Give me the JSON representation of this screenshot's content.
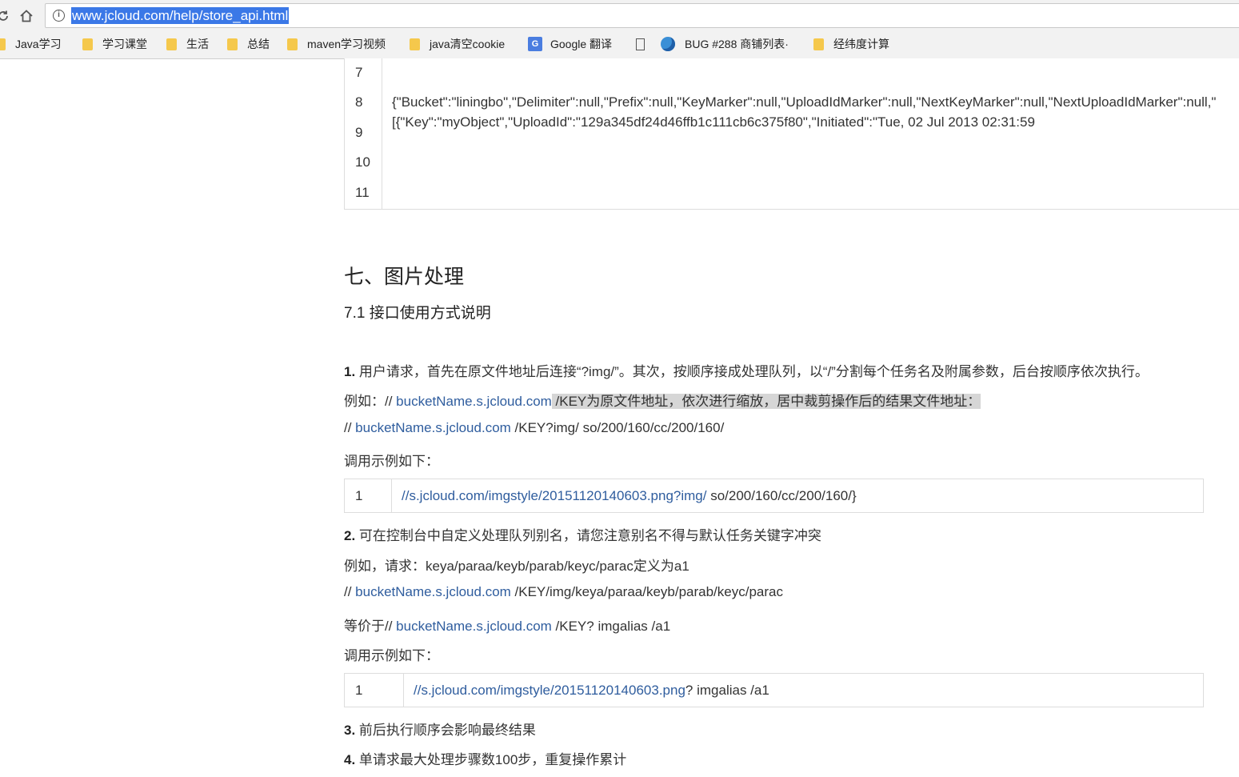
{
  "browser": {
    "reload_icon": "reload-icon",
    "home_icon": "home-icon",
    "url": "www.jcloud.com/help/store_api.html",
    "bookmarks": [
      {
        "label": "Java学习",
        "icon": "folder-icon"
      },
      {
        "label": "学习课堂",
        "icon": "folder-icon"
      },
      {
        "label": "生活",
        "icon": "folder-icon"
      },
      {
        "label": "总结",
        "icon": "folder-icon"
      },
      {
        "label": "maven学习视频",
        "icon": "folder-icon"
      },
      {
        "label": "java清空cookie",
        "icon": "folder-icon"
      },
      {
        "label": "Google 翻译",
        "icon": "google-translate-icon"
      },
      {
        "label": "",
        "icon": "page-icon"
      },
      {
        "label": "BUG #288 商铺列表·",
        "icon": "globe-icon"
      },
      {
        "label": "经纬度计算",
        "icon": "folder-icon"
      }
    ]
  },
  "code_top": {
    "line_numbers": [
      "7",
      "8",
      "9",
      "10",
      "11"
    ],
    "lines": [
      "{\"Bucket\":\"liningbo\",\"Delimiter\":null,\"Prefix\":null,\"KeyMarker\":null,\"UploadIdMarker\":null,\"NextKeyMarker\":null,\"NextUploadIdMarker\":null,\"",
      "[{\"Key\":\"myObject\",\"UploadId\":\"129a345df24d46ffb1c111cb6c375f80\",\"Initiated\":\"Tue, 02 Jul 2013 02:31:59"
    ]
  },
  "section": {
    "title": "七、图片处理",
    "subtitle": "7.1 接口使用方式说明"
  },
  "items": {
    "p1_num": "1.",
    "p1_text": " 用户请求，首先在原文件地址后连接“?img/”。其次，按顺序接成处理队列，以“/”分割每个任务名及附属参数，后台按顺序依次执行。",
    "p2_prefix": "例如：// ",
    "p2_link": "bucketName.s.jcloud.com",
    "p2_hl": " /KEY为原文件地址，依次进行缩放，居中裁剪操作后的结果文件地址：",
    "p3_prefix": "// ",
    "p3_link": "bucketName.s.jcloud.com",
    "p3_rest": " /KEY?img/ so/200/160/cc/200/160/",
    "p4": "调用示例如下：",
    "code1_num": "1",
    "code1_link": "//s.jcloud.com/imgstyle/20151120140603.png?img/",
    "code1_rest": " so/200/160/cc/200/160/}",
    "p5_num": "2.",
    "p5_text": " 可在控制台中自定义处理队列别名，请您注意别名不得与默认任务关键字冲突",
    "p6": "例如，请求：keya/paraa/keyb/parab/keyc/parac定义为a1",
    "p7_prefix": "// ",
    "p7_link": "bucketName.s.jcloud.com",
    "p7_rest": " /KEY/img/keya/paraa/keyb/parab/keyc/parac",
    "p8_prefix": "等价于// ",
    "p8_link": "bucketName.s.jcloud.com",
    "p8_rest": " /KEY? imgalias /a1",
    "p9": "调用示例如下：",
    "code2_num": "1",
    "code2_link": "//s.jcloud.com/imgstyle/20151120140603.png",
    "code2_rest": "? imgalias /a1",
    "p10_num": "3.",
    "p10_text": " 前后执行顺序会影响最终结果",
    "p11_num": "4.",
    "p11_text": " 单请求最大处理步骤数100步，重复操作累计"
  }
}
